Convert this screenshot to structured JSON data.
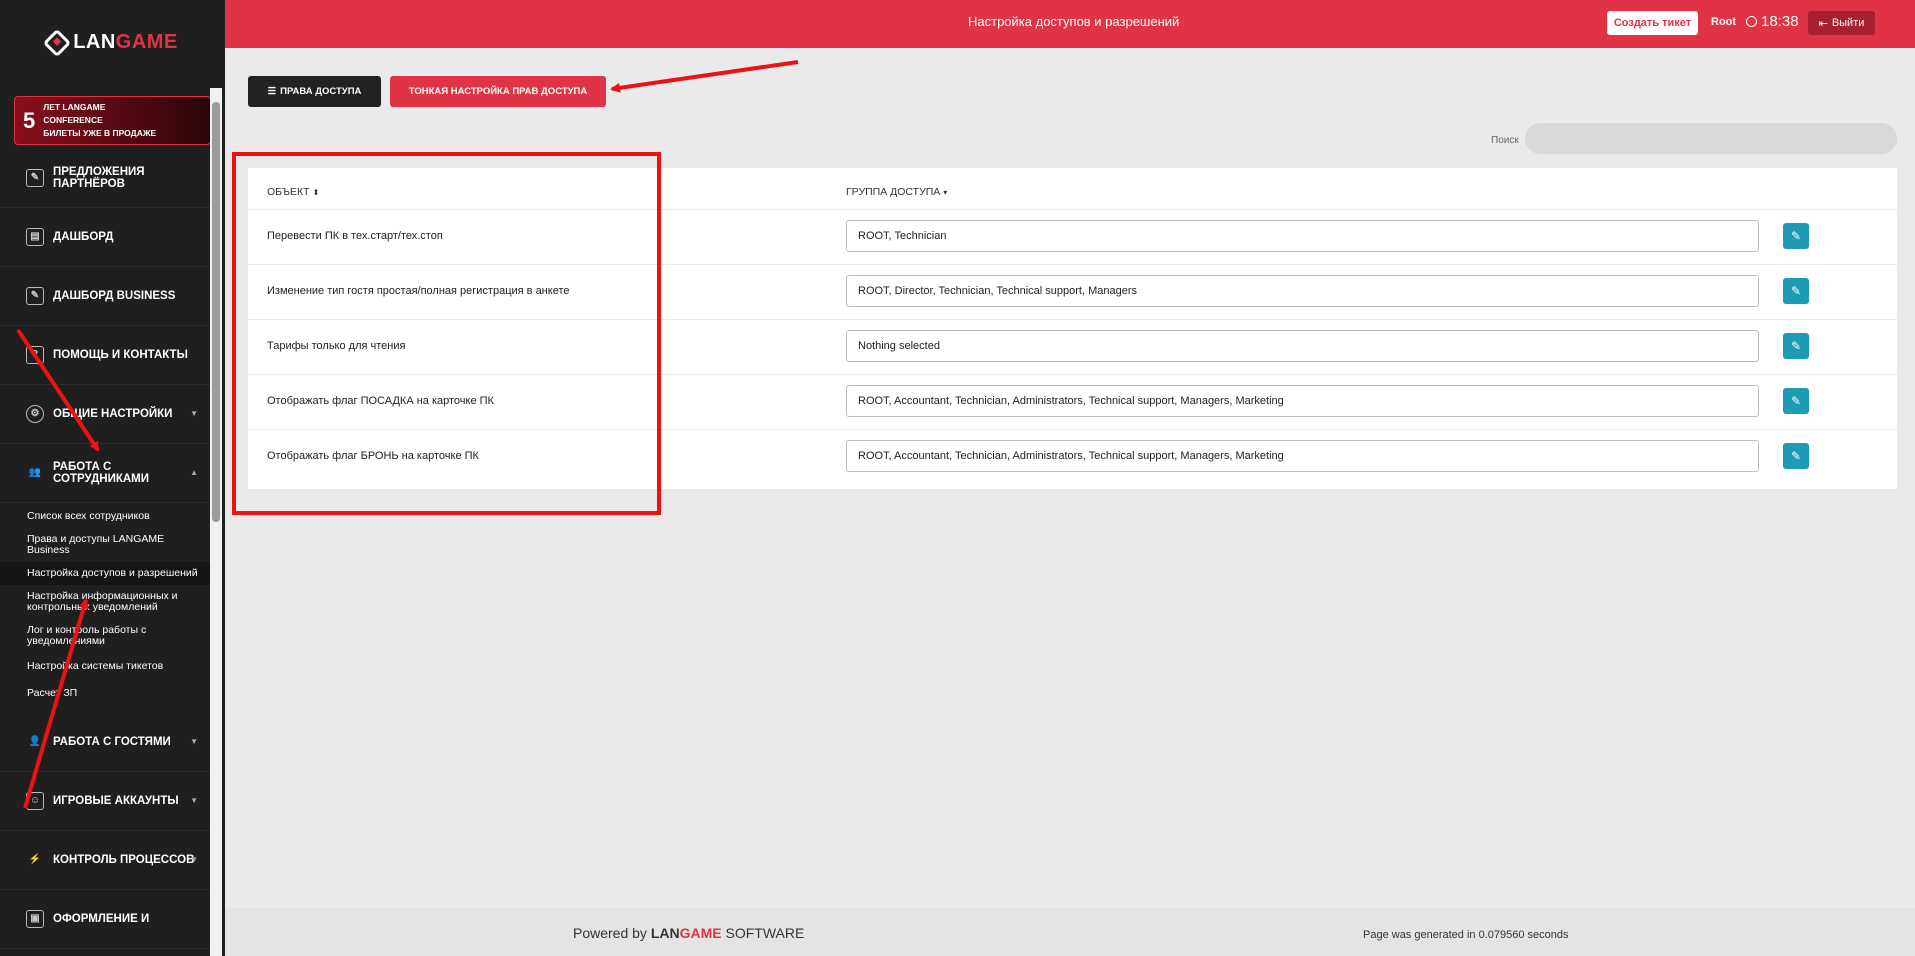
{
  "sidebar": {
    "logo": {
      "left": "LAN",
      "right": "GAME"
    },
    "promo": {
      "number": "5",
      "line1": "лет LANGAME",
      "line2": "CONFERENCE",
      "line3": "БИЛЕТЫ УЖЕ В ПРОДАЖЕ"
    },
    "items": [
      {
        "label": "ПРЕДЛОЖЕНИЯ ПАРТНЁРОВ",
        "icon": "edit-icon"
      },
      {
        "label": "ДАШБОРД",
        "icon": "book-icon"
      },
      {
        "label": "ДАШБОРД BUSINESS",
        "icon": "edit-icon"
      },
      {
        "label": "ПОМОЩЬ И КОНТАКТЫ",
        "icon": "help-icon"
      },
      {
        "label": "ОБЩИЕ НАСТРОЙКИ",
        "icon": "gear-icon"
      },
      {
        "label": "РАБОТА С СОТРУДНИКАМИ",
        "icon": "users-icon"
      }
    ],
    "sub_items": [
      "Список всех сотрудников",
      "Права и доступы LANGAME Business",
      "Настройка доступов и разрешений",
      "Настройка информационных и контрольных уведомлений",
      "Лог и контроль работы с уведомлениями",
      "Настройка системы тикетов",
      "Расчет ЗП"
    ],
    "items_bottom": [
      {
        "label": "РАБОТА С ГОСТЯМИ",
        "icon": "guests-icon"
      },
      {
        "label": "ИГРОВЫЕ АККАУНТЫ",
        "icon": "account-icon"
      },
      {
        "label": "КОНТРОЛЬ ПРОЦЕССОВ",
        "icon": "bolt-icon"
      },
      {
        "label": "ОФОРМЛЕНИЕ И",
        "icon": "design-icon"
      }
    ]
  },
  "topbar": {
    "title": "Настройка доступов и разрешений",
    "create_ticket": "Создать тикет",
    "user": "Root",
    "time": "18:38",
    "logout": "Выйти"
  },
  "tabs": {
    "access_rights": "ПРАВА ДОСТУПА",
    "fine_tuning": "ТОНКАЯ НАСТРОЙКА ПРАВ ДОСТУПА"
  },
  "search": {
    "label": "Поиск",
    "value": ""
  },
  "table": {
    "columns": [
      "ОБЪЕКТ",
      "ГРУППА ДОСТУПА"
    ],
    "rows": [
      {
        "object": "Перевести ПК в тех.старт/тех.стоп",
        "group": "ROOT, Technician"
      },
      {
        "object": "Изменение тип гостя простая/полная регистрация в анкете",
        "group": "ROOT, Director, Technician, Technical support, Managers"
      },
      {
        "object": "Тарифы только для чтения",
        "group": "Nothing selected"
      },
      {
        "object": "Отображать флаг ПОСАДКА на карточке ПК",
        "group": "ROOT, Accountant, Technician, Administrators, Technical support, Managers, Marketing"
      },
      {
        "object": "Отображать флаг БРОНЬ на карточке ПК",
        "group": "ROOT, Accountant, Technician, Administrators, Technical support, Managers, Marketing"
      }
    ]
  },
  "footer": {
    "powered_by": "Powered by",
    "brand_left": "LAN",
    "brand_right": "GAME",
    "software": "SOFTWARE",
    "generated": "Page was generated in 0.079560 seconds"
  },
  "colors": {
    "brand_red": "#e03345",
    "sidebar_bg": "#1f1f1f",
    "edit_button": "#1e9bb5",
    "annotation_red": "#ee1111"
  }
}
